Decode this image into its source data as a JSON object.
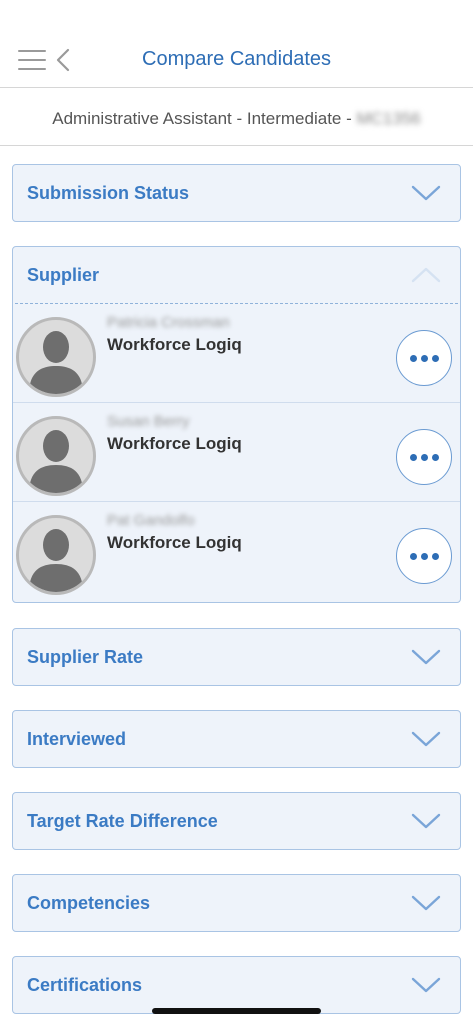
{
  "header": {
    "title": "Compare Candidates"
  },
  "subheader": {
    "job_title": "Administrative Assistant - Intermediate - ",
    "job_code": "MC1356"
  },
  "sections": {
    "submission_status": "Submission Status",
    "supplier": "Supplier",
    "supplier_rate": "Supplier Rate",
    "interviewed": "Interviewed",
    "target_rate_difference": "Target Rate Difference",
    "competencies": "Competencies",
    "certifications": "Certifications"
  },
  "candidates": [
    {
      "name": "Patricia Crossman",
      "supplier": "Workforce Logiq"
    },
    {
      "name": "Susan Berry",
      "supplier": "Workforce Logiq"
    },
    {
      "name": "Pat Gandolfo",
      "supplier": "Workforce Logiq"
    }
  ],
  "colors": {
    "accent": "#2d6db5",
    "panel_bg": "#eef3fa",
    "panel_border": "#a9c4e4"
  }
}
